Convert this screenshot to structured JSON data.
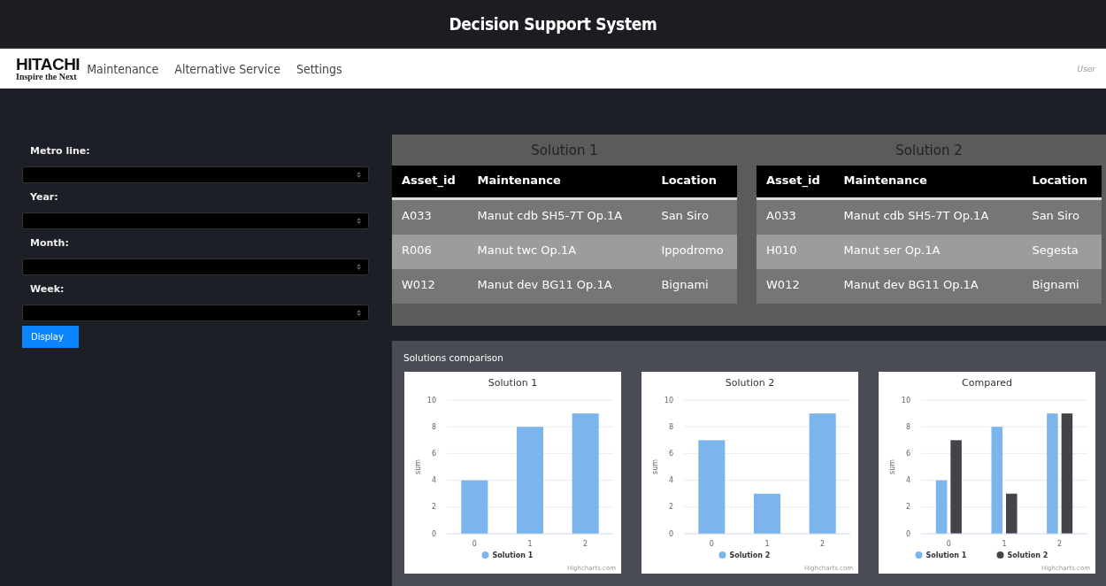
{
  "header": {
    "title": "Decision Support System"
  },
  "nav": {
    "logo": {
      "brand": "HITACHI",
      "tagline": "Inspire the Next"
    },
    "items": [
      "Maintenance",
      "Alternative Service",
      "Settings"
    ],
    "user": "User"
  },
  "filters": {
    "fields": [
      {
        "label": "Metro line:"
      },
      {
        "label": "Year:"
      },
      {
        "label": "Month:"
      },
      {
        "label": "Week:"
      }
    ],
    "button": "Display"
  },
  "solutions": [
    {
      "title": "Solution 1",
      "columns": [
        "Asset_id",
        "Maintenance",
        "Location"
      ],
      "rows": [
        [
          "A033",
          "Manut cdb SH5-7T Op.1A",
          "San Siro"
        ],
        [
          "R006",
          "Manut twc Op.1A",
          "Ippodromo"
        ],
        [
          "W012",
          "Manut dev BG11 Op.1A",
          "Bignami"
        ]
      ]
    },
    {
      "title": "Solution 2",
      "columns": [
        "Asset_id",
        "Maintenance",
        "Location"
      ],
      "rows": [
        [
          "A033",
          "Manut cdb SH5-7T Op.1A",
          "San Siro"
        ],
        [
          "H010",
          "Manut ser Op.1A",
          "Segesta"
        ],
        [
          "W012",
          "Manut dev BG11 Op.1A",
          "Bignami"
        ]
      ]
    }
  ],
  "comparison": {
    "title": "Solutions comparison",
    "charts": [
      {
        "credit": "Highcharts.com",
        "chart_data": {
          "type": "bar",
          "grid": true,
          "legend": "bottom",
          "title": "Solution 1",
          "ylabel": "sum",
          "categories": [
            "0",
            "1",
            "2"
          ],
          "ylim": [
            0,
            10
          ],
          "yticks": [
            0,
            2,
            4,
            6,
            8,
            10
          ],
          "series": [
            {
              "name": "Solution 1",
              "color": "#7cb5ec",
              "values": [
                4,
                8,
                9
              ]
            }
          ]
        }
      },
      {
        "credit": "Highcharts.com",
        "chart_data": {
          "type": "bar",
          "grid": true,
          "legend": "bottom",
          "title": "Solution 2",
          "ylabel": "sum",
          "categories": [
            "0",
            "1",
            "2"
          ],
          "ylim": [
            0,
            10
          ],
          "yticks": [
            0,
            2,
            4,
            6,
            8,
            10
          ],
          "series": [
            {
              "name": "Solution 2",
              "color": "#7cb5ec",
              "values": [
                7,
                3,
                9
              ]
            }
          ]
        }
      },
      {
        "credit": "Highcharts.com",
        "chart_data": {
          "type": "bar",
          "grid": true,
          "legend": "bottom",
          "title": "Compared",
          "ylabel": "sum",
          "categories": [
            "0",
            "1",
            "2"
          ],
          "ylim": [
            0,
            10
          ],
          "yticks": [
            0,
            2,
            4,
            6,
            8,
            10
          ],
          "series": [
            {
              "name": "Solution 1",
              "color": "#7cb5ec",
              "values": [
                4,
                8,
                9
              ]
            },
            {
              "name": "Solution 2",
              "color": "#434348",
              "values": [
                7,
                3,
                9
              ]
            }
          ]
        }
      }
    ]
  }
}
